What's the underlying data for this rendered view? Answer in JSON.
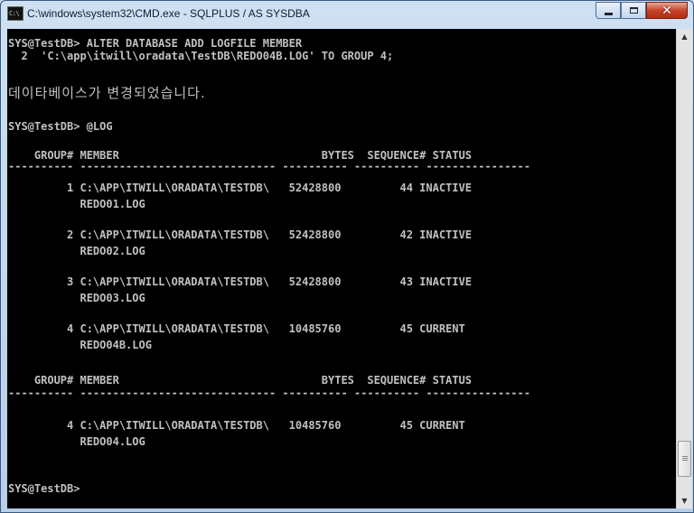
{
  "window": {
    "title": "C:\\windows\\system32\\CMD.exe - SQLPLUS  / AS SYSDBA",
    "icon_text": "C:\\",
    "icon": "console-window-icon"
  },
  "console": {
    "lines": [
      "SYS@TestDB> ALTER DATABASE ADD LOGFILE MEMBER",
      "  2  'C:\\app\\itwill\\oradata\\TestDB\\REDO04B.LOG' TO GROUP 4;",
      "데이타베이스가 변경되었습니다.",
      "SYS@TestDB> @LOG",
      "    GROUP# MEMBER                               BYTES  SEQUENCE# STATUS",
      "---------- ------------------------------ ---------- ---------- ----------------",
      "         1 C:\\APP\\ITWILL\\ORADATA\\TESTDB\\   52428800         44 INACTIVE",
      "           REDO01.LOG",
      "         2 C:\\APP\\ITWILL\\ORADATA\\TESTDB\\   52428800         42 INACTIVE",
      "           REDO02.LOG",
      "         3 C:\\APP\\ITWILL\\ORADATA\\TESTDB\\   52428800         43 INACTIVE",
      "           REDO03.LOG",
      "         4 C:\\APP\\ITWILL\\ORADATA\\TESTDB\\   10485760         45 CURRENT",
      "           REDO04B.LOG",
      "    GROUP# MEMBER                               BYTES  SEQUENCE# STATUS",
      "---------- ------------------------------ ---------- ---------- ----------------",
      "         4 C:\\APP\\ITWILL\\ORADATA\\TESTDB\\   10485760         45 CURRENT",
      "           REDO04.LOG",
      "SYS@TestDB>"
    ]
  },
  "colors": {
    "console_bg": "#000000",
    "console_text": "#c0c0c0",
    "titlebar": "#b9cfe8",
    "close_button": "#c8442b"
  }
}
